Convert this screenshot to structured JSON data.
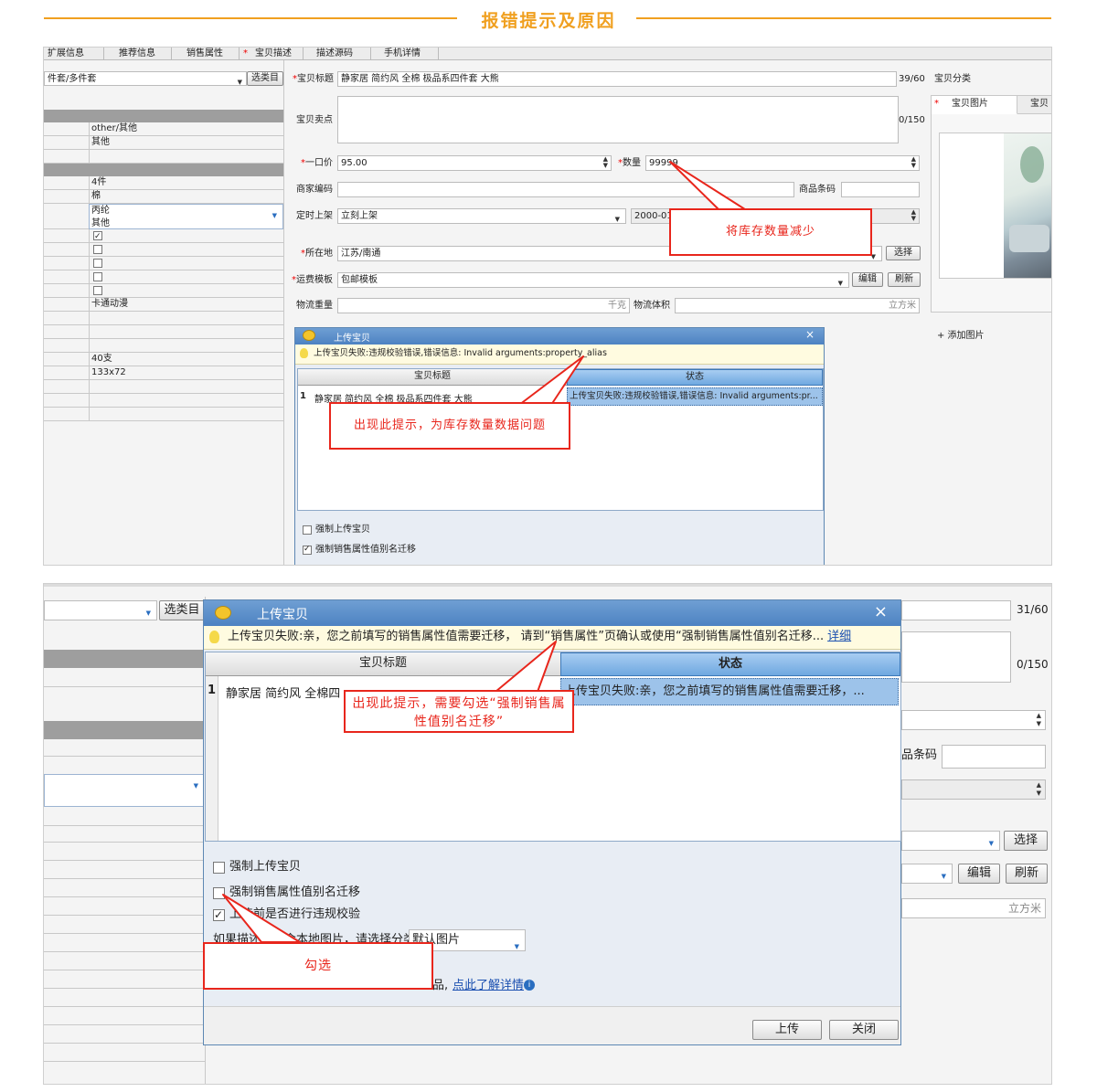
{
  "header": {
    "title": "报错提示及原因"
  },
  "shot1": {
    "tabs": [
      "扩展信息",
      "推荐信息",
      "销售属性",
      "*",
      "宝贝描述",
      "描述源码",
      "手机详情"
    ],
    "category": {
      "value": "件套/多件套",
      "button": "选类目"
    },
    "left_rows": [
      "other/其他",
      "其他",
      "4件",
      "棉",
      "丙纶",
      "其他",
      "卡通动漫",
      "40支",
      "133x72"
    ],
    "form": {
      "title_label": "宝贝标题",
      "title_value": "静家居 简约风 全棉 极品系四件套 大熊",
      "title_count": "39/60",
      "selling_label": "宝贝卖点",
      "selling_count": "0/150",
      "category_label": "宝贝分类",
      "price_label": "一口价",
      "price_value": "95.00",
      "qty_label": "数量",
      "qty_value": "99999",
      "merchant_code_label": "商家编码",
      "barcode_label": "商品条码",
      "schedule_label": "定时上架",
      "schedule_value": "立刻上架",
      "date_value": "2000-01-",
      "location_label": "所在地",
      "location_value": "江苏/南通",
      "location_button": "选择",
      "freight_label": "运费模板",
      "freight_value": "包邮模板",
      "edit_button": "编辑",
      "refresh_button": "刷新",
      "weight_label": "物流重量",
      "weight_unit": "千克",
      "volume_label": "物流体积",
      "volume_unit": "立方米",
      "image_tab": "宝贝图片",
      "image_tab2": "宝贝",
      "add_image": "+ 添加图片"
    },
    "dialog": {
      "title": "上传宝贝",
      "close": "×",
      "tip": "上传宝贝失败:违规校验错误,错误信息: Invalid arguments:property_alias",
      "col_title": "宝贝标题",
      "col_status": "状态",
      "row_index": "1",
      "row_title": "静家居 简约风 全棉 极品系四件套 大熊",
      "row_status": "上传宝贝失败:违规校验错误,错误信息: Invalid arguments:pr...",
      "opt1": "强制上传宝贝",
      "opt2": "强制销售属性值别名迁移"
    },
    "callout_qty": "将库存数量减少",
    "callout_tip": "出现此提示，为库存数量数据问题"
  },
  "shot2": {
    "category_button": "选类目",
    "count_title": "31/60",
    "count_selling": "0/150",
    "barcode_label": "品条码",
    "select_button": "选择",
    "edit_button": "编辑",
    "refresh_button": "刷新",
    "volume_unit": "立方米",
    "dialog": {
      "title": "上传宝贝",
      "close": "×",
      "tip": "上传宝贝失败:亲，您之前填写的销售属性值需要迁移， 请到“销售属性”页确认或使用“强制销售属性值别名迁移...",
      "tip_link": "详细",
      "col_title": "宝贝标题",
      "col_status": "状态",
      "row_index": "1",
      "row_title": "静家居 简约风 全棉四",
      "row_status": "上传宝贝失败:亲，您之前填写的销售属性值需要迁移，...",
      "opt1": "强制上传宝贝",
      "opt2": "强制销售属性值别名迁移",
      "opt3": "上传前是否进行违规校验",
      "image_label": "如果描述中包含本地图片，请选择分类",
      "image_value": "默认图片",
      "bottom_text": "品,",
      "learn_more": "点此了解详情",
      "upload_button": "上传",
      "close_button": "关闭"
    },
    "callout_tip": "出现此提示，需要勾选“强制销售属性值别名迁移”",
    "callout_check": "勾选"
  }
}
